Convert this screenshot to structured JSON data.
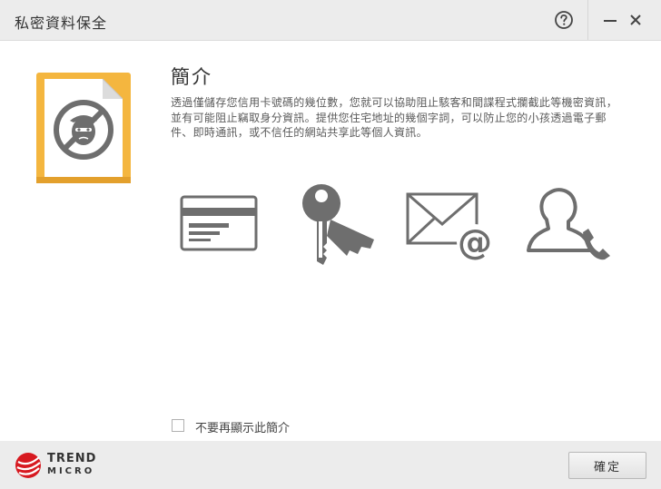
{
  "window": {
    "title": "私密資料保全"
  },
  "titlebar": {
    "help_icon": "question-circle-icon",
    "minimize_icon": "minimize-icon",
    "close_icon": "close-icon"
  },
  "main": {
    "heading": "簡介",
    "description": "透過僅儲存您信用卡號碼的幾位數，您就可以協助阻止駭客和間諜程式攔截此等機密資訊，並有可能阻止竊取身分資訊。提供您住宅地址的幾個字詞，可以防止您的小孩透過電子郵件、即時通訊，或不信任的網站共享此等個人資訊。",
    "hero_icon": "privacy-thief-icon",
    "features": [
      {
        "icon": "credit-card-icon"
      },
      {
        "icon": "key-icon"
      },
      {
        "icon": "email-at-icon"
      },
      {
        "icon": "contact-phone-icon"
      }
    ],
    "dont_show_again": {
      "label": "不要再顯示此簡介",
      "checked": false
    }
  },
  "footer": {
    "brand": {
      "line1": "TREND",
      "line2": "MICRO"
    },
    "ok_button": "確定"
  },
  "colors": {
    "accent_folder": "#f4b63f",
    "brand_red": "#d71920",
    "icon_gray": "#6e6e6e"
  }
}
